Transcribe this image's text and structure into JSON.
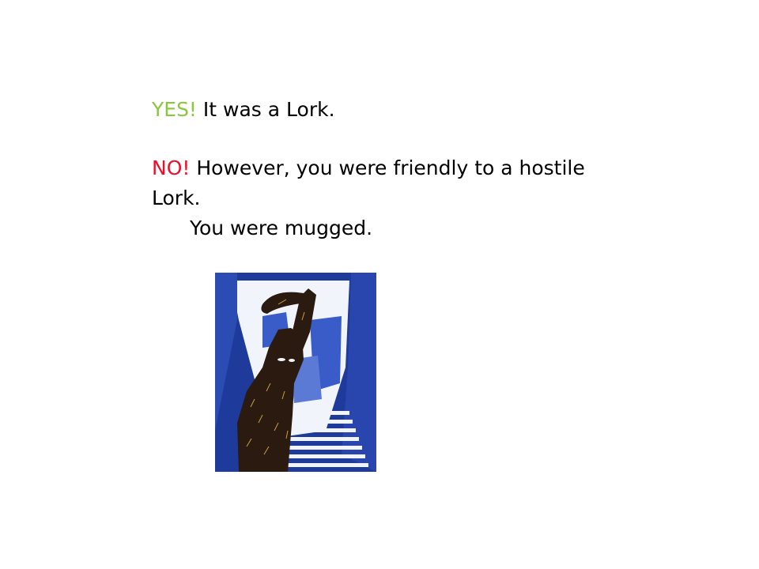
{
  "slide": {
    "yes_line": {
      "keyword": "YES!",
      "text": " It was a Lork.",
      "keyword_color": "#8cc63f"
    },
    "no_line": {
      "keyword": "NO!",
      "text": " However, you were friendly to a hostile",
      "keyword_color": "#e8102a"
    },
    "continuation": "Lork.",
    "outcome": "You were mugged."
  },
  "illustration": {
    "subject": "silhouetted Lork swinging a club in a blue alley",
    "colors": {
      "sky": "#f2f4fb",
      "dark_blue": "#1e3a9a",
      "mid_blue": "#3a5cc8",
      "figure": "#2a1a10"
    }
  }
}
